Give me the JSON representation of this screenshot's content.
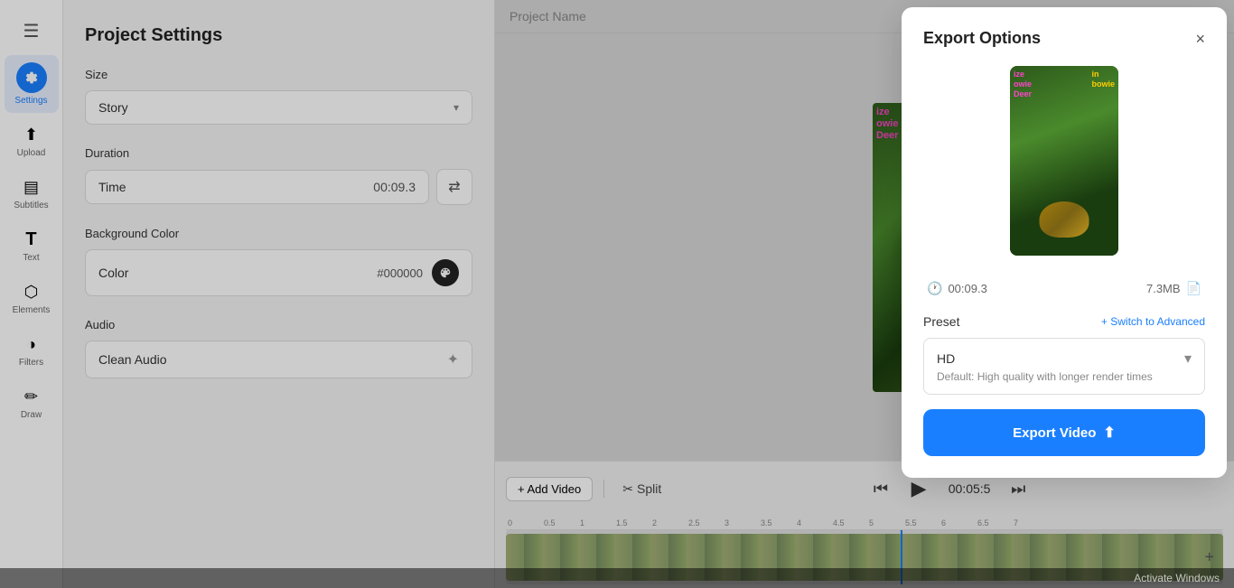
{
  "sidebar": {
    "menu_icon": "☰",
    "items": [
      {
        "id": "settings",
        "label": "Settings",
        "icon": "⚙",
        "active": true
      },
      {
        "id": "upload",
        "label": "Upload",
        "icon": "⬆",
        "active": false
      },
      {
        "id": "subtitles",
        "label": "Subtitles",
        "icon": "▤",
        "active": false
      },
      {
        "id": "text",
        "label": "Text",
        "icon": "T",
        "active": false
      },
      {
        "id": "elements",
        "label": "Elements",
        "icon": "◈",
        "active": false
      },
      {
        "id": "filters",
        "label": "Filters",
        "icon": "◑",
        "active": false
      },
      {
        "id": "draw",
        "label": "Draw",
        "icon": "✏",
        "active": false
      }
    ]
  },
  "settings_panel": {
    "title": "Project Settings",
    "size_section": {
      "label": "Size",
      "value": "Story"
    },
    "duration_section": {
      "label": "Duration",
      "field_label": "Time",
      "value": "00:09.3"
    },
    "background_section": {
      "label": "Background Color",
      "field_label": "Color",
      "hex_value": "#000000"
    },
    "audio_section": {
      "label": "Audio",
      "value": "Clean Audio"
    }
  },
  "preview": {
    "project_name": "Project Name"
  },
  "timeline": {
    "add_video_label": "+ Add Video",
    "split_label": "Split",
    "time_display": "00:05:5",
    "ruler_marks": [
      "0",
      "0.5",
      "1",
      "1.5",
      "2",
      "2.5",
      "3",
      "3.5",
      "4",
      "4.5",
      "5",
      "5.5",
      "6",
      "6.5",
      "7"
    ],
    "zoom_plus": "+",
    "zoom_minus": "−"
  },
  "export_modal": {
    "title": "Export Options",
    "close": "×",
    "duration": "00:09.3",
    "file_size": "7.3MB",
    "preset_label": "Preset",
    "switch_label": "+ Switch to Advanced",
    "preset_name": "HD",
    "preset_desc": "Default: High quality with longer render times",
    "export_btn_label": "Export Video",
    "activate_text": "Activate Windows"
  }
}
